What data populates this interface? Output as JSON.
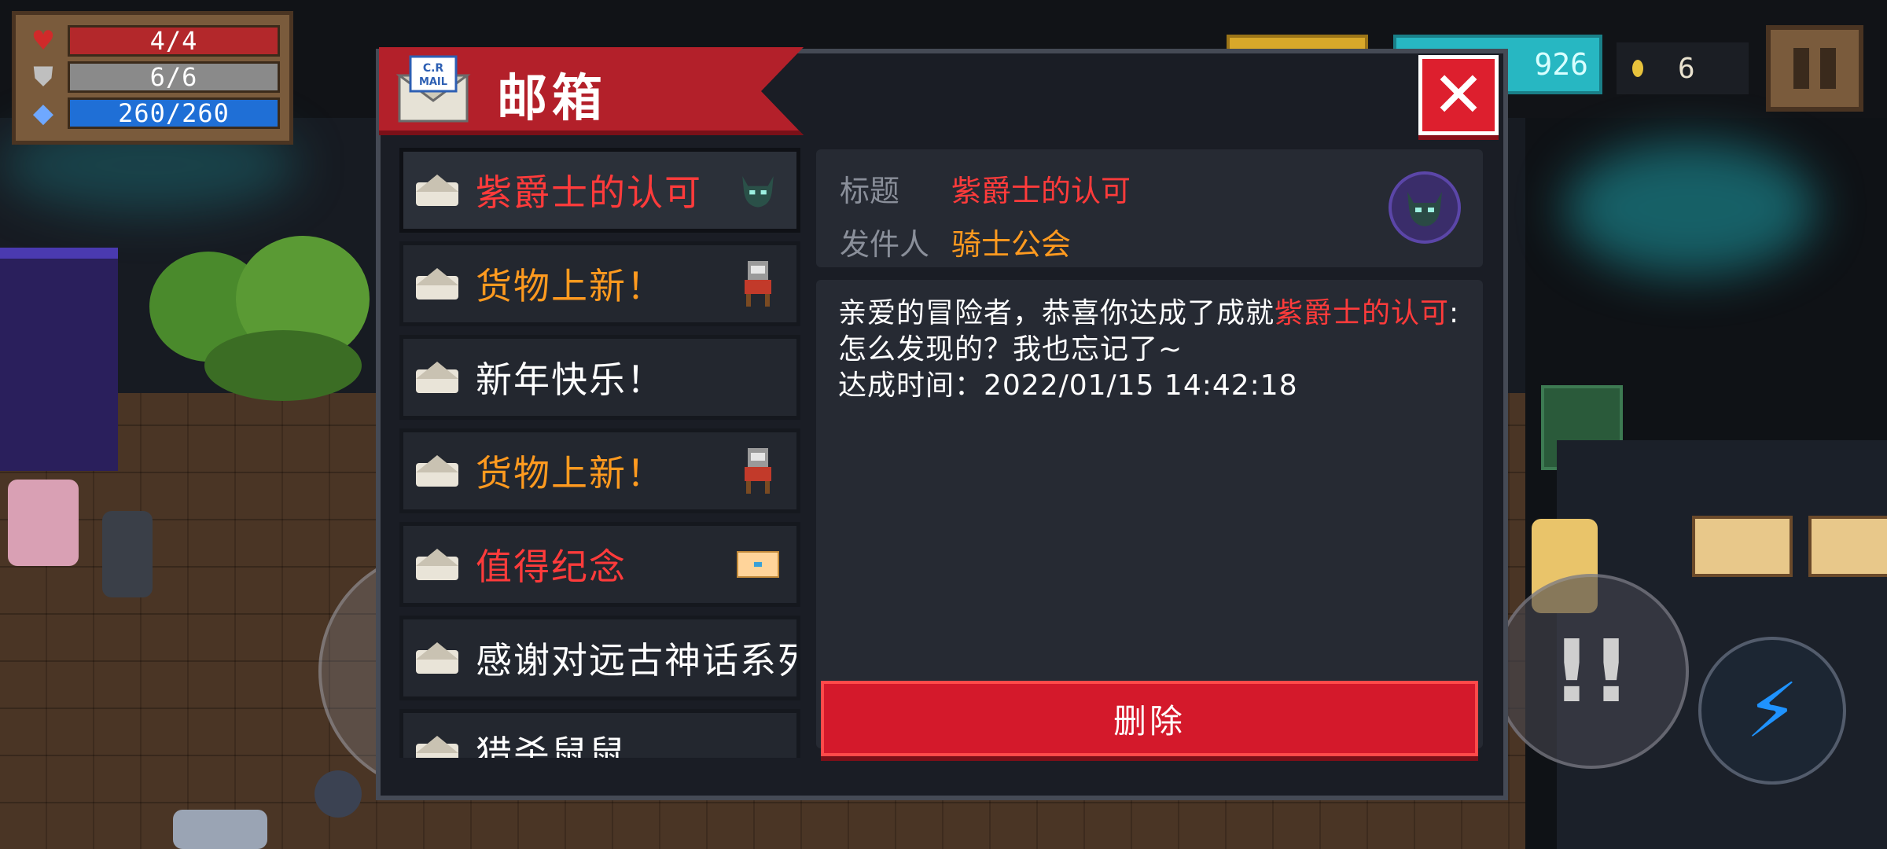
{
  "hud": {
    "health": "4/4",
    "armor": "6/6",
    "energy": "260/260",
    "gems": "926",
    "coins": "6"
  },
  "mailbox": {
    "title": "邮箱",
    "badge_text": "C.R MAIL",
    "close_label": "✕",
    "items": [
      {
        "subject": "紫爵士的认可",
        "color": "#ff3b3b",
        "sender_icon": "knight-helmet-icon"
      },
      {
        "subject": "货物上新！",
        "color": "#ff9a1f",
        "sender_icon": "merchant-icon"
      },
      {
        "subject": "新年快乐！",
        "color": "#ffffff",
        "sender_icon": ""
      },
      {
        "subject": "货物上新！",
        "color": "#ff9a1f",
        "sender_icon": "merchant-icon"
      },
      {
        "subject": "值得纪念",
        "color": "#ff3b3b",
        "sender_icon": "screen-icon"
      },
      {
        "subject": "感谢对远古神话系列",
        "color": "#ffffff",
        "sender_icon": ""
      },
      {
        "subject": "猎杀鼠鼠",
        "color": "#ffffff",
        "sender_icon": ""
      }
    ],
    "detail": {
      "title_label": "标题",
      "title_value": "紫爵士的认可",
      "sender_label": "发件人",
      "sender_value": "骑士公会",
      "body_part1": "亲爱的冒险者，恭喜你达成了成就",
      "body_highlight": "紫爵士的认可",
      "body_part2": ":怎么发现的？我也忘记了~",
      "body_line2": "达成时间：2022/01/15 14:42:18"
    },
    "delete_label": "删除"
  },
  "colors": {
    "accent_red": "#d4192b",
    "highlight_red": "#ff3b3b",
    "highlight_orange": "#ff9a1f"
  }
}
